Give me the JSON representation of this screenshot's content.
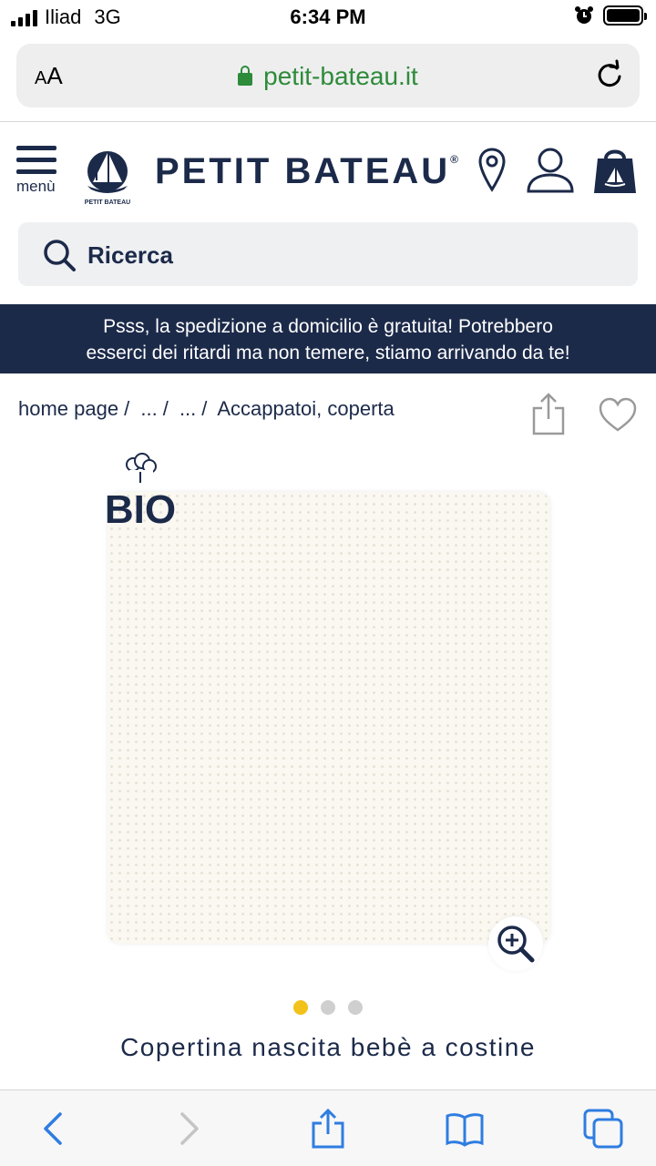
{
  "status_bar": {
    "carrier": "Iliad",
    "network": "3G",
    "time": "6:34 PM"
  },
  "browser": {
    "text_size_label": "AA",
    "url": "petit-bateau.it"
  },
  "header": {
    "menu_label": "menù",
    "brand": "PETIT BATEAU",
    "brand_mark": "®",
    "logo_text": "PETIT BATEAU"
  },
  "search": {
    "placeholder": "Ricerca"
  },
  "promo": {
    "line1": "Psss, la spedizione a domicilio è gratuita! Potrebbero",
    "line2": "esserci dei ritardi ma non temere, stiamo arrivando da te!"
  },
  "breadcrumb": {
    "items": [
      "home page",
      "...",
      "...",
      "Accappatoi, coperta"
    ]
  },
  "product": {
    "badge": "BIO",
    "title": "Copertina nascita bebè a costine",
    "image_count": 3,
    "active_image": 1
  },
  "colors": {
    "navy": "#1c2a4a",
    "url_green": "#2e8b3a",
    "dot_active": "#f2c21b",
    "toolbar_blue": "#2f7de1"
  }
}
